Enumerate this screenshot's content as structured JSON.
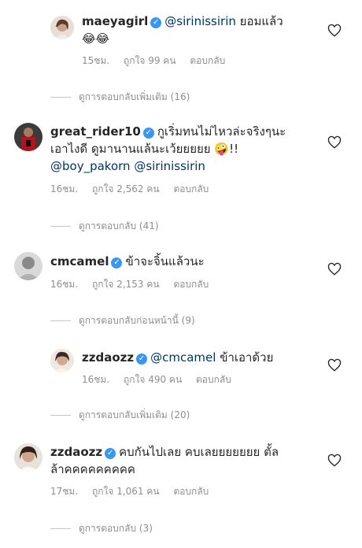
{
  "comments": [
    {
      "username": "maeyagirl",
      "mention": "@sirinissirin",
      "text": "ยอมแล้ว",
      "emoji": "😂😂",
      "time": "15ชม.",
      "likes": "ถูกใจ 99 คน",
      "reply": "ตอบกลับ",
      "view_replies": "ดูการตอบกลับเพิ่มเติม (16)",
      "avatar_icon": "avatar-photo"
    },
    {
      "username": "great_rider10",
      "text_line1": "กูเริ่มทนไม่ไหวล่ะจริงๆนะ",
      "text_line2": "เอาไงดี ดูมานานแล้นะเว้ยยยยย",
      "emoji": "🤪",
      "exclaim": "!!",
      "mention1": "@boy_pakorn",
      "mention2": "@sirinissirin",
      "time": "16ชม.",
      "likes": "ถูกใจ 2,562 คน",
      "reply": "ตอบกลับ",
      "view_replies": "ดูการตอบกลับ (41)",
      "avatar_icon": "avatar-photo"
    },
    {
      "username": "cmcamel",
      "text": "ข้าจะจิ้นแล้วนะ",
      "time": "16ชม.",
      "likes": "ถูกใจ 2,153 คน",
      "reply": "ตอบกลับ",
      "view_replies": "ดูการตอบกลับก่อนหน้านี้ (9)",
      "avatar_icon": "avatar-photo"
    },
    {
      "username": "zzdaozz",
      "mention": "@cmcamel",
      "text": "ข้าเอาด้วย",
      "time": "16ชม.",
      "likes": "ถูกใจ 490 คน",
      "reply": "ตอบกลับ",
      "view_replies": "ดูการตอบกลับเพิ่มเติม (20)",
      "avatar_icon": "avatar-photo"
    },
    {
      "username": "zzdaozz",
      "text_line1": "คบกันไปเลย คบเลยยยยยยย ตั้ล",
      "text_line2": "ล้าคคคคคคคคค",
      "time": "17ชม.",
      "likes": "ถูกใจ 1,061 คน",
      "reply": "ตอบกลับ",
      "view_replies": "ดูการตอบกลับ (3)",
      "avatar_icon": "avatar-photo"
    }
  ],
  "icons": {
    "verified": "verified-badge-icon",
    "like": "heart-icon"
  },
  "colors": {
    "verified": "#3897f0",
    "mention": "#003569",
    "meta": "#8e8e8e"
  }
}
